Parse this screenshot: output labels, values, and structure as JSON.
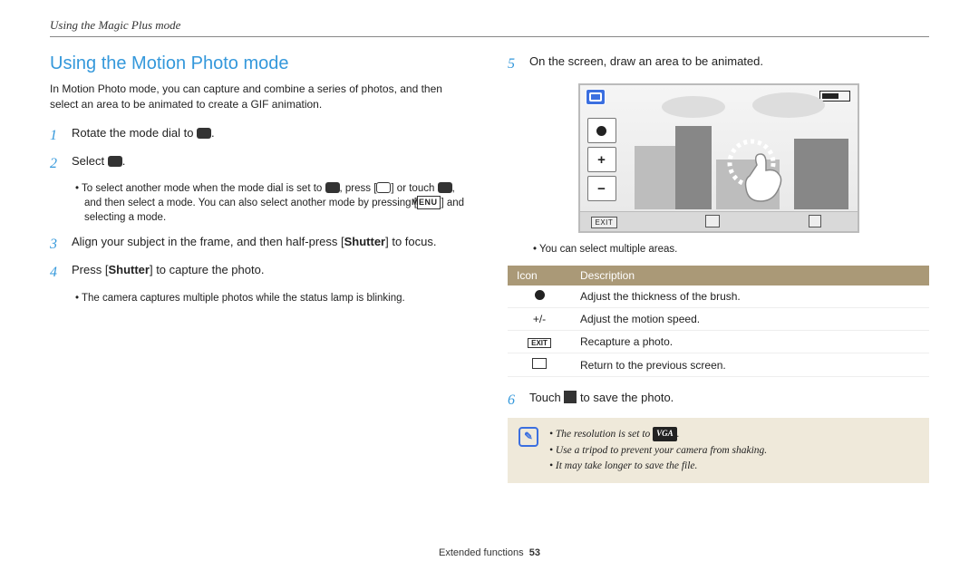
{
  "header": {
    "breadcrumb": "Using the Magic Plus mode"
  },
  "title": "Using the Motion Photo mode",
  "intro": "In Motion Photo mode, you can capture and combine a series of photos, and then select an area to be animated to create a GIF animation.",
  "steps": {
    "s1": {
      "num": "1",
      "text_a": "Rotate the mode dial to ",
      "text_b": "."
    },
    "s2": {
      "num": "2",
      "text_a": "Select ",
      "text_b": ".",
      "sub_a": "To select another mode when the mode dial is set to ",
      "sub_b": ", press [",
      "sub_c": "] or touch ",
      "sub_d": ", and then select a mode. You can also select another mode by pressing [",
      "sub_e": "] and selecting a mode.",
      "menu": "MENU"
    },
    "s3": {
      "num": "3",
      "text_a": "Align your subject in the frame, and then half-press [",
      "shutter": "Shutter",
      "text_b": "] to focus."
    },
    "s4": {
      "num": "4",
      "text_a": "Press [",
      "shutter": "Shutter",
      "text_b": "] to capture the photo.",
      "sub": "The camera captures multiple photos while the status lamp is blinking."
    },
    "s5": {
      "num": "5",
      "text": "On the screen, draw an area to be animated.",
      "sub": "You can select multiple areas."
    },
    "s6": {
      "num": "6",
      "text_a": "Touch ",
      "text_b": " to save the photo."
    }
  },
  "illus": {
    "exit": "EXIT",
    "plus": "+",
    "minus": "−"
  },
  "table": {
    "headers": {
      "icon": "Icon",
      "desc": "Description"
    },
    "rows": [
      {
        "icon_key": "dot",
        "desc": "Adjust the thickness of the brush."
      },
      {
        "icon_key": "pm",
        "icon_text": "+/-",
        "desc": "Adjust the motion speed."
      },
      {
        "icon_key": "exit",
        "icon_text": "EXIT",
        "desc": "Recapture a photo."
      },
      {
        "icon_key": "ret",
        "desc": "Return to the previous screen."
      }
    ]
  },
  "note": {
    "bullets": [
      {
        "a": "The resolution is set to ",
        "chip": "VGA",
        "b": "."
      },
      {
        "a": "Use a tripod to prevent your camera from shaking."
      },
      {
        "a": "It may take longer to save the file."
      }
    ]
  },
  "footer": {
    "label": "Extended functions",
    "page": "53"
  }
}
